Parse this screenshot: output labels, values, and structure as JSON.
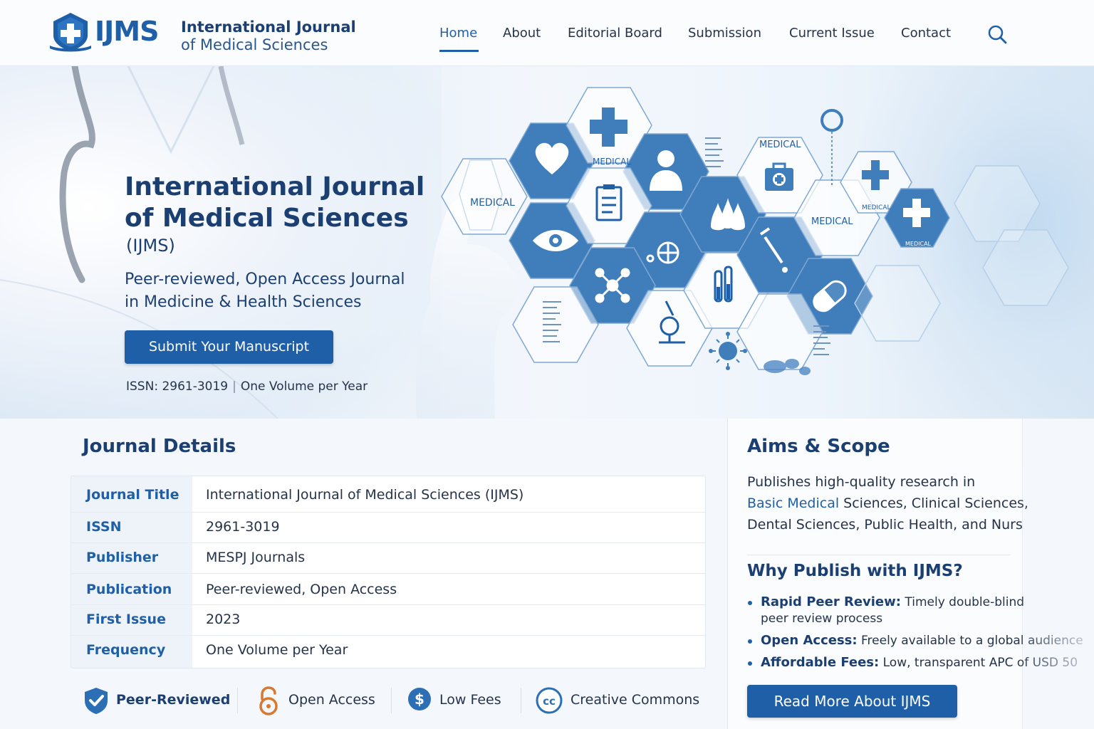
{
  "brand": {
    "logo_text": "IJMS",
    "name_line1": "International Journal",
    "name_line2": "of Medical Sciences"
  },
  "nav": {
    "items": [
      {
        "label": "Home",
        "active": true
      },
      {
        "label": "About"
      },
      {
        "label": "Editorial Board"
      },
      {
        "label": "Submission"
      },
      {
        "label": "Current Issue"
      },
      {
        "label": "Contact"
      }
    ],
    "search_icon": "search-icon"
  },
  "hero": {
    "title_line1": "International Journal",
    "title_line2": "of Medical Sciences",
    "abbr": "(IJMS)",
    "tagline_line1": "Peer-reviewed, Open Access Journal",
    "tagline_line2": "in Medicine & Health Sciences",
    "cta_label": "Submit Your Manuscript",
    "issn_text": "ISSN: 2961-3019",
    "separator": "|",
    "frequency_text": "One Volume per Year",
    "hex_labels": [
      "MEDICAL",
      "MEDICAL",
      "MEDICAL",
      "MEDICAL",
      "MEDICAL",
      "MEDICAL"
    ]
  },
  "journal_details": {
    "title": "Journal Details",
    "rows": [
      {
        "label": "Journal Title",
        "value": "International Journal of Medical Sciences (IJMS)"
      },
      {
        "label": "ISSN",
        "value": "2961-3019"
      },
      {
        "label": "Publisher",
        "value": "MESPJ Journals"
      },
      {
        "label": "Publication",
        "value": "Peer-reviewed, Open Access"
      },
      {
        "label": "First Issue",
        "value": "2023"
      },
      {
        "label": "Frequency",
        "value": "One Volume per Year"
      }
    ]
  },
  "badges": [
    {
      "label": "Peer-Reviewed",
      "icon": "shield-check-icon"
    },
    {
      "label": "Open Access",
      "icon": "open-lock-icon"
    },
    {
      "label": "Low Fees",
      "icon": "dollar-coin-icon"
    },
    {
      "label": "Creative Commons",
      "icon": "creative-commons-icon"
    }
  ],
  "aims": {
    "title": "Aims & Scope",
    "text_pre": "Publishes high-quality research in",
    "text_highlight": "Basic Medical",
    "text_post": " Sciences, Clinical Sciences, Dental Sciences, Public Health, and Nurs"
  },
  "why": {
    "title": "Why Publish with IJMS?",
    "items": [
      {
        "bold": "Rapid Peer Review:",
        "text": " Timely double-blind peer review process"
      },
      {
        "bold": "Open Access:",
        "text": " Freely available to a global audience"
      },
      {
        "bold": "Affordable Fees:",
        "text": " Low, transparent APC of USD 50"
      }
    ],
    "cta_label": "Read More About IJMS"
  },
  "colors": {
    "primary": "#1f5fa7",
    "navy": "#1c3f72",
    "hex_fill": "#3f7dbb"
  }
}
